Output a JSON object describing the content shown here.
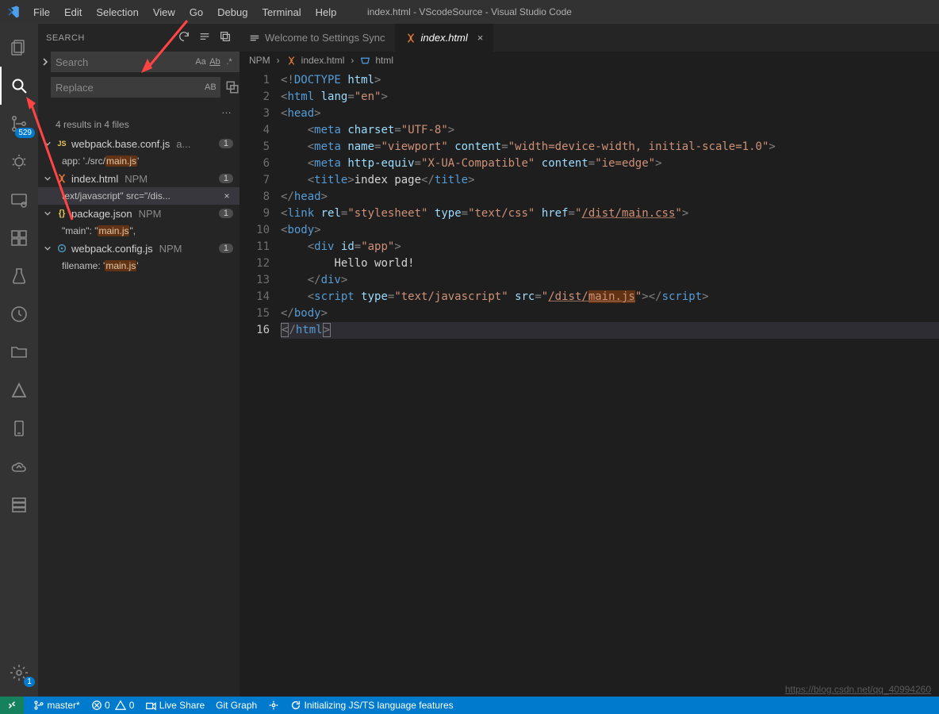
{
  "title": "index.html - VScodeSource - Visual Studio Code",
  "menu": [
    "File",
    "Edit",
    "Selection",
    "View",
    "Go",
    "Debug",
    "Terminal",
    "Help"
  ],
  "activitybar": {
    "explorer_badge": "",
    "scm_badge": "529",
    "settings_badge": "1"
  },
  "sidebar": {
    "title": "SEARCH",
    "search_placeholder": "Search",
    "replace_placeholder": "Replace",
    "match_case": "Aa",
    "whole_word": "Ab̲",
    "regex": ".*",
    "preserve_case": "AB",
    "more": "…",
    "results_summary": "4 results in 4 files",
    "results": [
      {
        "file": "webpack.base.conf.js",
        "suffix": "a...",
        "icon": "js",
        "count": "1",
        "matches": [
          {
            "pre": "app: './src/",
            "hl": "main.js",
            "post": "'"
          }
        ]
      },
      {
        "file": "index.html",
        "suffix": "NPM",
        "icon": "html",
        "count": "1",
        "matches": [
          {
            "pre": "text/javascript\" src=\"/dis",
            "hl": "",
            "post": "...",
            "selected": true
          }
        ]
      },
      {
        "file": "package.json",
        "suffix": "NPM",
        "icon": "json",
        "count": "1",
        "matches": [
          {
            "pre": "\"main\": \"",
            "hl": "main.js",
            "post": "\","
          }
        ]
      },
      {
        "file": "webpack.config.js",
        "suffix": "NPM",
        "icon": "jsfile",
        "count": "1",
        "matches": [
          {
            "pre": "filename: '",
            "hl": "main.js",
            "post": "'"
          }
        ]
      }
    ]
  },
  "tabs": [
    {
      "label": "Welcome to Settings Sync",
      "icon": "settings",
      "active": false
    },
    {
      "label": "index.html",
      "icon": "html",
      "active": true,
      "closable": true
    }
  ],
  "breadcrumb": {
    "root": "NPM",
    "file": "index.html",
    "symbol": "html"
  },
  "code": {
    "lines": [
      {
        "n": 1,
        "html": "<span class='d-br'>&lt;!</span><span class='d-doctype'>DOCTYPE</span> <span class='d-attr'>html</span><span class='d-br'>&gt;</span>"
      },
      {
        "n": 2,
        "html": "<span class='d-br'>&lt;</span><span class='d-el'>html</span> <span class='d-attr'>lang</span><span class='d-br'>=</span><span class='d-str'>\"en\"</span><span class='d-br'>&gt;</span>"
      },
      {
        "n": 3,
        "html": "<span class='d-br'>&lt;</span><span class='d-el'>head</span><span class='d-br'>&gt;</span>"
      },
      {
        "n": 4,
        "html": "    <span class='d-br'>&lt;</span><span class='d-el'>meta</span> <span class='d-attr'>charset</span><span class='d-br'>=</span><span class='d-str'>\"UTF-8\"</span><span class='d-br'>&gt;</span>"
      },
      {
        "n": 5,
        "html": "    <span class='d-br'>&lt;</span><span class='d-el'>meta</span> <span class='d-attr'>name</span><span class='d-br'>=</span><span class='d-str'>\"viewport\"</span> <span class='d-attr'>content</span><span class='d-br'>=</span><span class='d-str'>\"width=device-width, initial-scale=1.0\"</span><span class='d-br'>&gt;</span>"
      },
      {
        "n": 6,
        "html": "    <span class='d-br'>&lt;</span><span class='d-el'>meta</span> <span class='d-attr'>http-equiv</span><span class='d-br'>=</span><span class='d-str'>\"X-UA-Compatible\"</span> <span class='d-attr'>content</span><span class='d-br'>=</span><span class='d-str'>\"ie=edge\"</span><span class='d-br'>&gt;</span>"
      },
      {
        "n": 7,
        "html": "    <span class='d-br'>&lt;</span><span class='d-el'>title</span><span class='d-br'>&gt;</span><span class='d-text'>index page</span><span class='d-br'>&lt;/</span><span class='d-el'>title</span><span class='d-br'>&gt;</span>"
      },
      {
        "n": 8,
        "html": "<span class='d-br'>&lt;/</span><span class='d-el'>head</span><span class='d-br'>&gt;</span>"
      },
      {
        "n": 9,
        "html": "<span class='d-br'>&lt;</span><span class='d-el'>link</span> <span class='d-attr'>rel</span><span class='d-br'>=</span><span class='d-str'>\"stylesheet\"</span> <span class='d-attr'>type</span><span class='d-br'>=</span><span class='d-str'>\"text/css\"</span> <span class='d-attr'>href</span><span class='d-br'>=</span><span class='d-str'>\"<span class='link-u'>/dist/main.css</span>\"</span><span class='d-br'>&gt;</span>"
      },
      {
        "n": 10,
        "html": "<span class='d-br'>&lt;</span><span class='d-el'>body</span><span class='d-br'>&gt;</span>"
      },
      {
        "n": 11,
        "html": "    <span class='d-br'>&lt;</span><span class='d-el'>div</span> <span class='d-attr'>id</span><span class='d-br'>=</span><span class='d-str'>\"app\"</span><span class='d-br'>&gt;</span>"
      },
      {
        "n": 12,
        "html": "        <span class='d-text'>Hello world!</span>"
      },
      {
        "n": 13,
        "html": "    <span class='d-br'>&lt;/</span><span class='d-el'>div</span><span class='d-br'>&gt;</span>"
      },
      {
        "n": 14,
        "html": "    <span class='d-br'>&lt;</span><span class='d-el'>script</span> <span class='d-attr'>type</span><span class='d-br'>=</span><span class='d-str'>\"text/javascript\"</span> <span class='d-attr'>src</span><span class='d-br'>=</span><span class='d-str'>\"<span class='link-u'>/dist/<span class='hl-code'>main.js</span></span>\"</span><span class='d-br'>&gt;&lt;/</span><span class='d-el'>script</span><span class='d-br'>&gt;</span>"
      },
      {
        "n": 15,
        "html": "<span class='d-br'>&lt;/</span><span class='d-el'>body</span><span class='d-br'>&gt;</span>"
      },
      {
        "n": 16,
        "current": true,
        "html": "<span class='cur-line'><span class='sel-box'><span class='d-br'>&lt;</span></span><span class='d-br'>/</span><span class='d-el'>html</span><span class='sel-box'><span class='d-br'>&gt;</span></span></span>"
      }
    ]
  },
  "statusbar": {
    "branch": "master*",
    "errors": "0",
    "warnings": "0",
    "liveshare": "Live Share",
    "gitgraph": "Git Graph",
    "init": "Initializing JS/TS language features"
  },
  "watermark": "https://blog.csdn.net/qq_40994260"
}
